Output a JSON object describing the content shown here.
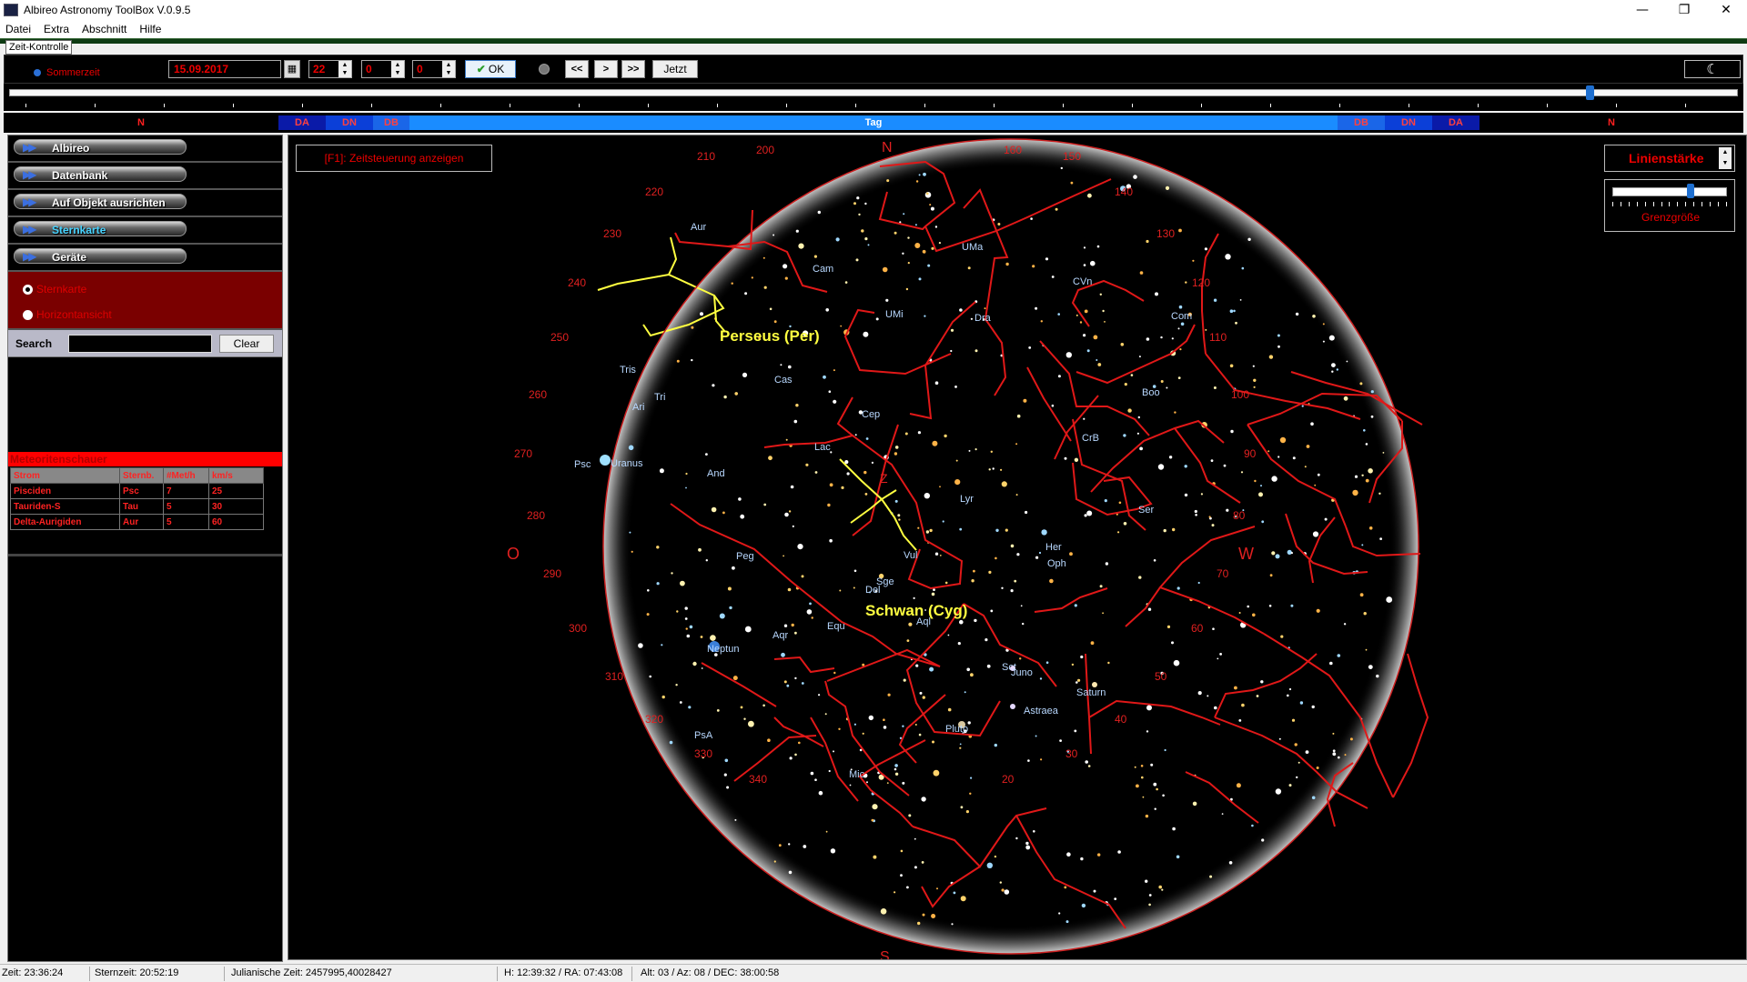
{
  "window": {
    "title": "Albireo Astronomy ToolBox V.0.9.5",
    "controls": {
      "minimize": "—",
      "maximize": "❐",
      "close": "✕"
    }
  },
  "menu": [
    "Datei",
    "Extra",
    "Abschnitt",
    "Hilfe"
  ],
  "time_control": {
    "tab_label": "Zeit-Kontrolle",
    "dst_label": "Sommerzeit",
    "date": "15.09.2017",
    "hour": "22",
    "minute": "0",
    "second": "0",
    "ok_label": "OK",
    "back_label": "<<",
    "play_label": ">",
    "ff_label": ">>",
    "now_label": "Jetzt",
    "slider_value": 0.914
  },
  "day_bands": [
    {
      "label": "N",
      "color": "#000000",
      "text": "#ff2020"
    },
    {
      "label": "DA",
      "color": "#0a1aa8",
      "text": "#ff4040"
    },
    {
      "label": "DN",
      "color": "#0b3fd8",
      "text": "#ff4040"
    },
    {
      "label": "DB",
      "color": "#1a66e8",
      "text": "#ff4040"
    },
    {
      "label": "Tag",
      "color": "#1a8cff",
      "text": "#ffffff"
    },
    {
      "label": "DB",
      "color": "#1a66e8",
      "text": "#ff4040"
    },
    {
      "label": "DN",
      "color": "#0b3fd8",
      "text": "#ff4040"
    },
    {
      "label": "DA",
      "color": "#0a1aa8",
      "text": "#ff4040"
    },
    {
      "label": "N",
      "color": "#000000",
      "text": "#ff2020"
    }
  ],
  "sidebar": {
    "sections": [
      "Albireo",
      "Datenbank",
      "Auf Objekt ausrichten",
      "Sternkarte",
      "Geräte"
    ],
    "active_section": "Sternkarte",
    "view_modes": [
      "Sternkarte",
      "Horizontansicht"
    ],
    "selected_mode": "Sternkarte",
    "dots": "........",
    "search_label": "Search",
    "search_value": "",
    "clear_label": "Clear"
  },
  "meteor": {
    "title": "Meteoritenschauer",
    "headers": [
      "Strom",
      "Sternb.",
      "#Met/h",
      "km/s"
    ],
    "rows": [
      [
        "Pisciden",
        "Psc",
        "7",
        "25"
      ],
      [
        "Tauriden-S",
        "Tau",
        "5",
        "30"
      ],
      [
        "Delta-Aurigiden",
        "Aur",
        "5",
        "60"
      ]
    ]
  },
  "skymap": {
    "f1_label": "[F1]: Zeitsteuerung anzeigen",
    "line_width_label": "Linienstärke",
    "limit_mag_label": "Grenzgröße",
    "limit_mag_value": 0.68,
    "cardinals": {
      "N": "N",
      "S": "S",
      "E": "O",
      "W": "W",
      "Z": "Z"
    },
    "azimuth_labels": [
      "200",
      "160",
      "210",
      "150",
      "220",
      "140",
      "230",
      "130",
      "240",
      "120",
      "250",
      "110",
      "260",
      "100",
      "270",
      "90",
      "280",
      "80",
      "290",
      "70",
      "300",
      "60",
      "310",
      "50",
      "320",
      "40",
      "330",
      "30",
      "340",
      "20"
    ],
    "highlight_labels": [
      "Perseus (Per)",
      "Schwan (Cyg)"
    ],
    "constellation_labels": [
      "Aur",
      "Cam",
      "UMa",
      "CVn",
      "Com",
      "Dra",
      "UMi",
      "Tri",
      "Ari",
      "Cas",
      "Boo",
      "Cep",
      "CrB",
      "Lac",
      "And",
      "Lyr",
      "Ser",
      "Psc",
      "Vul",
      "Her",
      "Peg",
      "Oph",
      "Sge",
      "Del",
      "Equ",
      "Aql",
      "Aqr",
      "Sct",
      "PsA",
      "Mic",
      "Tris"
    ],
    "planet_labels": [
      "Uranus",
      "Neptun",
      "Juno",
      "Saturn",
      "Astraea",
      "Pluto"
    ],
    "colors": {
      "line": "#e01818",
      "highlight": "#ffff40",
      "horizon": "#cc1f1f",
      "label": "#b8d8ff",
      "azimuth": "#e02020"
    }
  },
  "status": {
    "time": "Zeit: 23:36:24",
    "sidereal": "Sternzeit: 20:52:19",
    "julian": "Julianische Zeit: 2457995,40028427",
    "hour_angle": "H: 12:39:32 / RA: 07:43:08",
    "alt_az": "Alt: 03 / Az: 08 / DEC: 38:00:58"
  }
}
